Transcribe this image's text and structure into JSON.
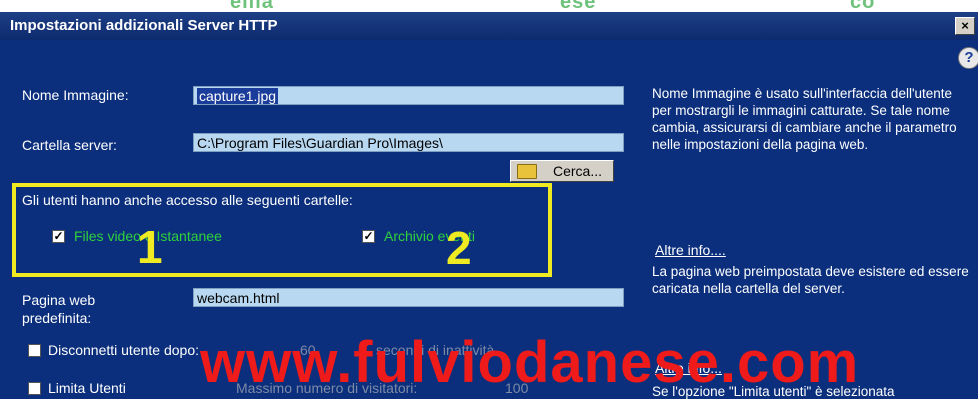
{
  "window": {
    "title": "Impostazioni addizionali Server HTTP",
    "close_label": "×",
    "help_label": "?"
  },
  "watermark_top": [
    "ellia",
    "ese",
    "co"
  ],
  "form": {
    "image_name_label": "Nome Immagine:",
    "image_name_value": "capture1.jpg",
    "server_folder_label": "Cartella server:",
    "server_folder_value": "C:\\Program Files\\Guardian Pro\\Images\\",
    "browse_button": "Cerca...",
    "access_label": "Gli utenti hanno anche accesso alle seguenti cartelle:",
    "video_files_label": "Files video e Istantanee",
    "event_archive_label": "Archivio eventi",
    "default_page_label": "Pagina web",
    "default_page_label2": "predefinita:",
    "default_page_value": "webcam.html",
    "disconnect_label": "Disconnetti utente dopo:",
    "disconnect_value": "60",
    "disconnect_unit": "secondi di inattività",
    "limit_users_label": "Limita Utenti",
    "max_visitors_label": "Massimo numero di visitatori:",
    "max_visitors_value": "100"
  },
  "annotations": {
    "marker_1": "1",
    "marker_2": "2",
    "highlight_color": "#f0ea22"
  },
  "side_panel": {
    "info_1": "Nome Immagine è usato sull'interfaccia dell'utente per mostrargli le immagini catturate. Se tale nome cambia, assicurarsi di cambiare anche il parametro nelle impostazioni della pagina web.",
    "link_1": "Altre info....",
    "info_2": "La pagina web preimpostata deve esistere ed essere caricata nella cartella del server.",
    "link_2": "Altre info...",
    "info_3": "Se l'opzione \"Limita utenti\" è selezionata"
  },
  "overlay_watermark": "www.fulviodanese.com",
  "colors": {
    "titlebar": "#0d2a6e",
    "client_bg": "#0b2f7d",
    "field_bg": "#b8d8f2",
    "watermark_red": "#ef1a1a",
    "checkbox_text_green": "#2fd23a"
  }
}
